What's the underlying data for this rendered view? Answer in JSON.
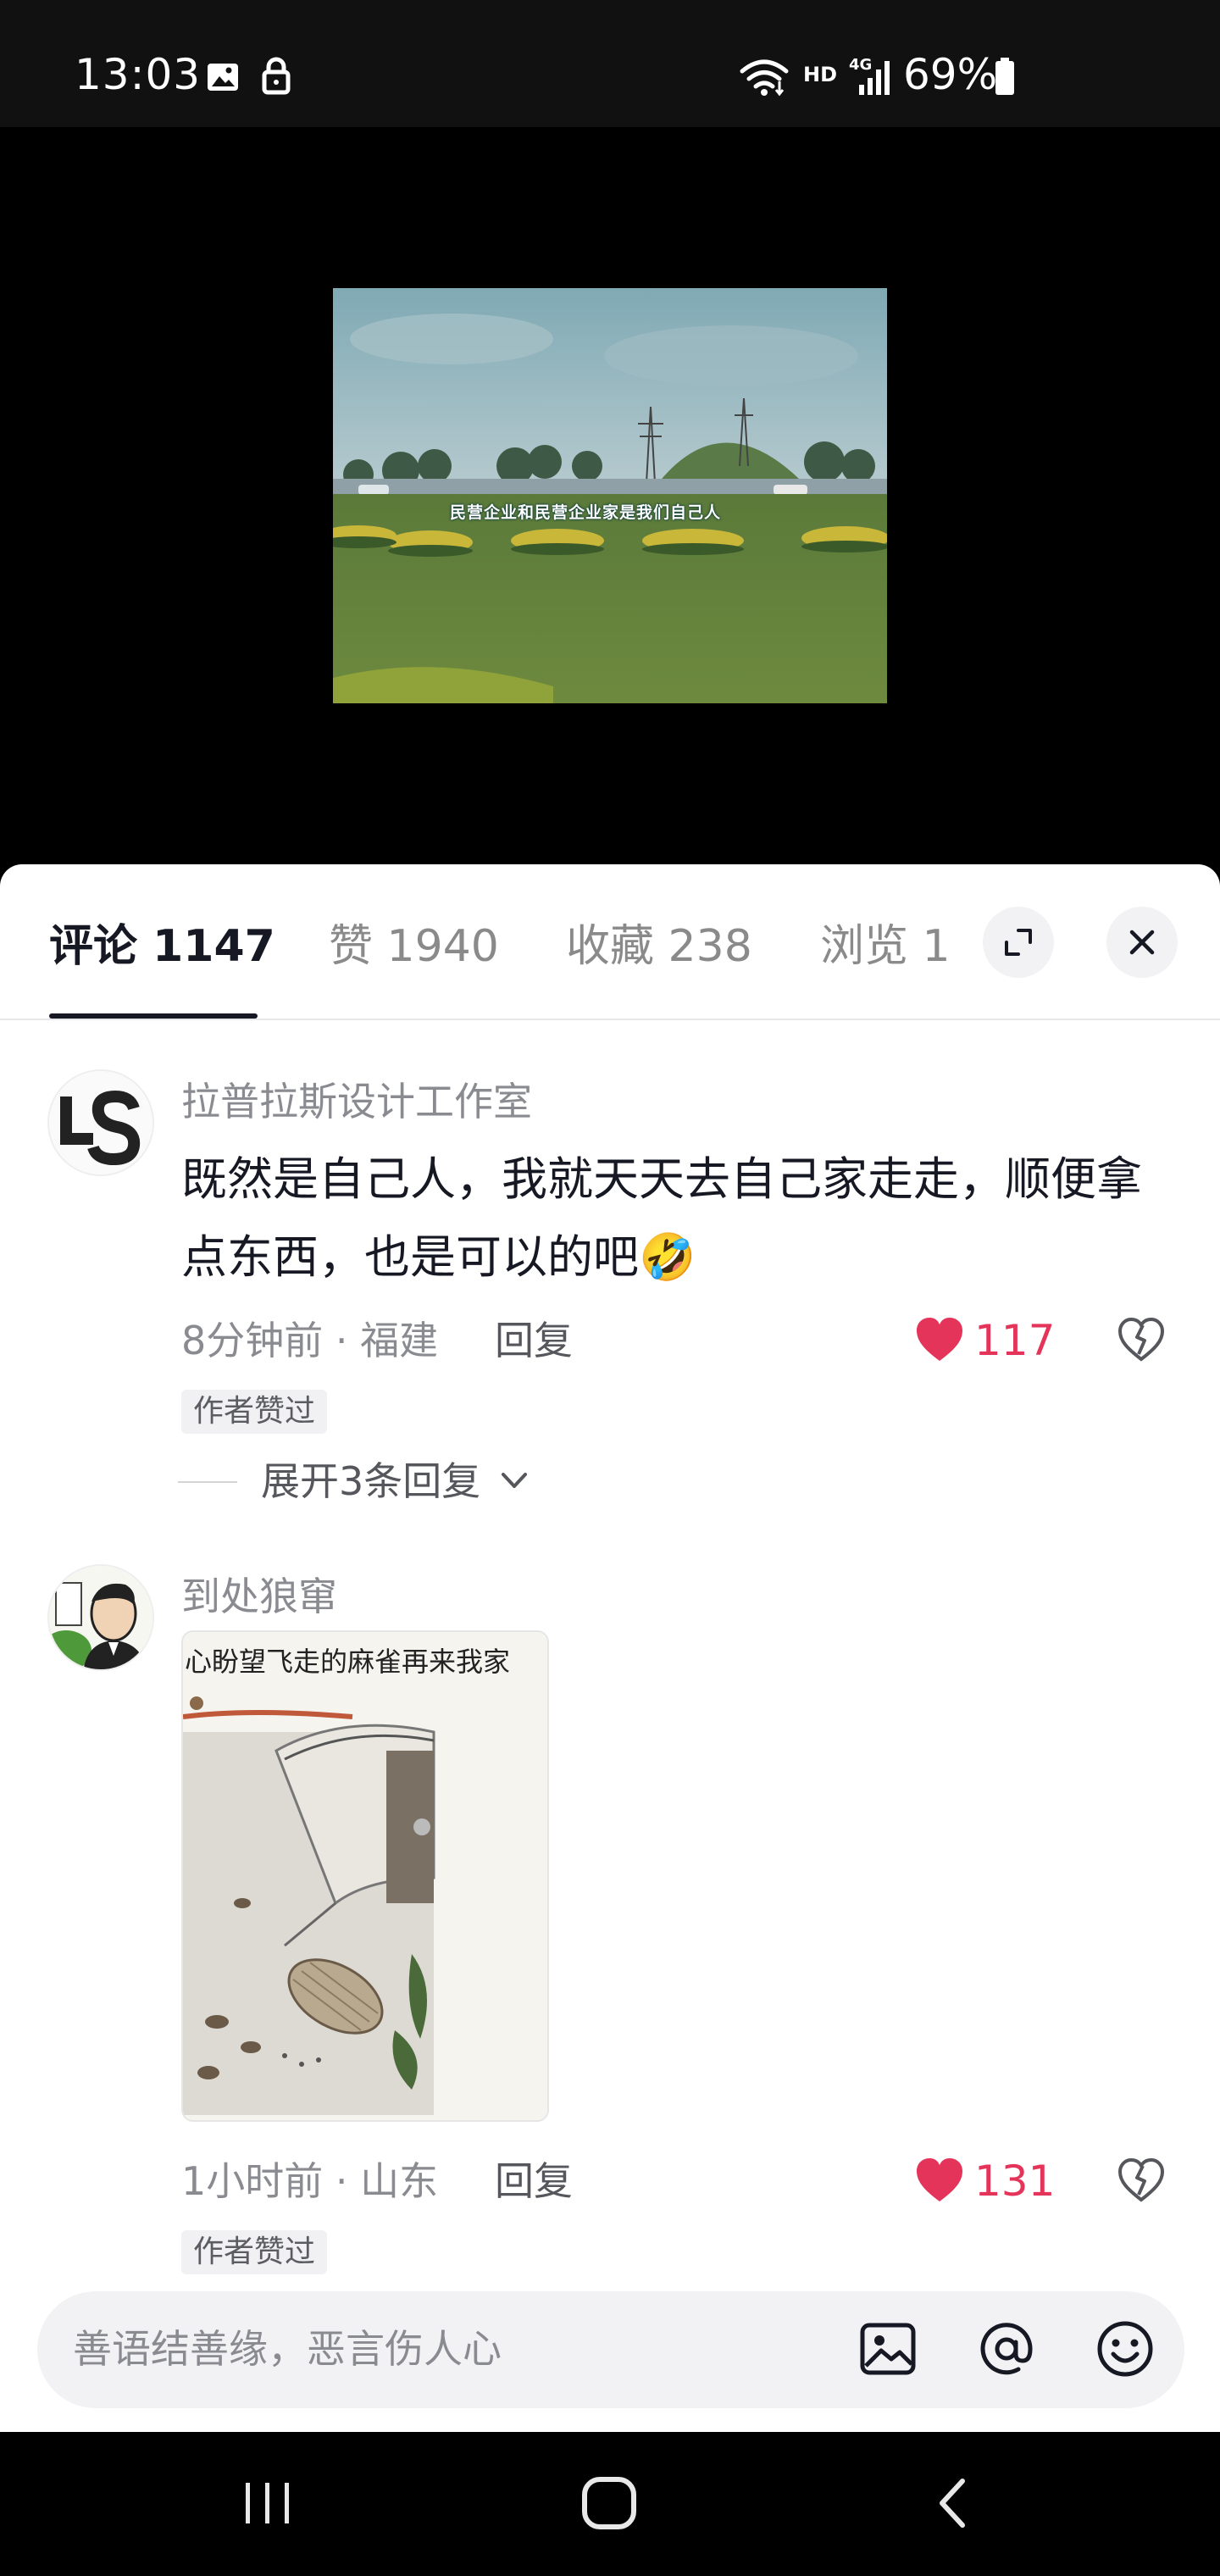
{
  "status_bar": {
    "time": "13:03",
    "network": "HD",
    "signal": "4G",
    "battery": "69%",
    "icons": [
      "gallery-icon",
      "lock-icon",
      "wifi-icon",
      "signal-icon",
      "battery-icon"
    ]
  },
  "video": {
    "caption": "民营企业和民营企业家是我们自己人"
  },
  "tabs": [
    {
      "label": "评论 1147",
      "active": true
    },
    {
      "label": "赞 1940",
      "active": false
    },
    {
      "label": "收藏 238",
      "active": false
    },
    {
      "label": "浏览 1",
      "active": false
    }
  ],
  "header_buttons": [
    "expand-icon",
    "close-icon"
  ],
  "comments": [
    {
      "user": "拉普拉斯设计工作室",
      "text": "既然是自己人，我就天天去自己家走走，顺便拿点东西，也是可以的吧🤣",
      "time_location": "8分钟前 · 福建",
      "reply_label": "回复",
      "likes": "117",
      "badge": "作者赞过",
      "expand_replies": "展开3条回复"
    },
    {
      "user": "到处狼窜",
      "image_caption": "心盼望飞走的麻雀再来我家",
      "time_location": "1小时前 · 山东",
      "reply_label": "回复",
      "likes": "131",
      "badge": "作者赞过"
    }
  ],
  "input": {
    "placeholder": "善语结善缘，恶言伤人心",
    "icons": [
      "image-icon",
      "at-icon",
      "emoji-icon"
    ]
  },
  "nav_bar": {
    "icons": [
      "recent-apps-icon",
      "home-icon",
      "back-icon"
    ]
  },
  "colors": {
    "accent_like": "#e5345a",
    "text_primary": "#161823",
    "text_secondary": "#8a8b91"
  }
}
